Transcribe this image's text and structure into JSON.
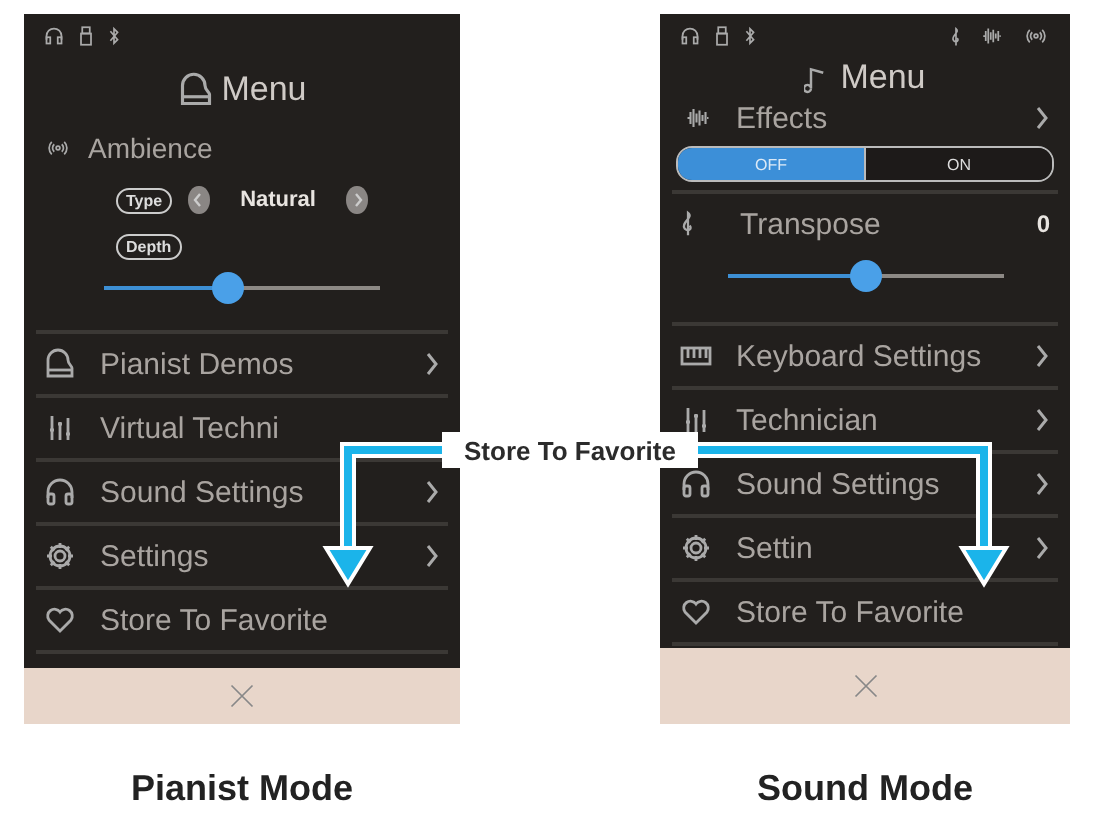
{
  "screens": [
    {
      "kind": "pianist",
      "title": "Menu",
      "caption": "Pianist Mode",
      "ambience": {
        "label": "Ambience",
        "type_label": "Type",
        "type_value": "Natural",
        "depth_label": "Depth",
        "level": 0.45
      },
      "items": [
        {
          "kind": "piano",
          "label": "Pianist Demos",
          "has_arrow": true
        },
        {
          "kind": "technician",
          "label": "Virtual Techni",
          "has_arrow": false
        },
        {
          "kind": "headphones",
          "label": "Sound Settings",
          "has_arrow": true
        },
        {
          "kind": "gear",
          "label": "Settings",
          "has_arrow": true
        },
        {
          "kind": "heart",
          "label": "Store To Favorite",
          "has_arrow": false
        }
      ]
    },
    {
      "kind": "sound",
      "title": "Menu",
      "caption": "Sound Mode",
      "effects": {
        "label": "Effects",
        "has_arrow": true,
        "options": [
          {
            "label": "OFF",
            "selected": true
          },
          {
            "label": "ON",
            "selected": false
          }
        ]
      },
      "transpose": {
        "label": "Transpose",
        "value": "0",
        "level": 0.5
      },
      "items": [
        {
          "kind": "keyboard",
          "label": "Keyboard Settings",
          "has_arrow": true
        },
        {
          "kind": "technician",
          "label": "Technician",
          "has_arrow": true
        },
        {
          "kind": "headphones",
          "label": "Sound Settings",
          "has_arrow": true
        },
        {
          "kind": "gear",
          "label": "Settin",
          "has_arrow": true
        },
        {
          "kind": "heart",
          "label": "Store To Favorite",
          "has_arrow": false
        }
      ]
    }
  ],
  "callout": {
    "label": "Store To Favorite"
  }
}
